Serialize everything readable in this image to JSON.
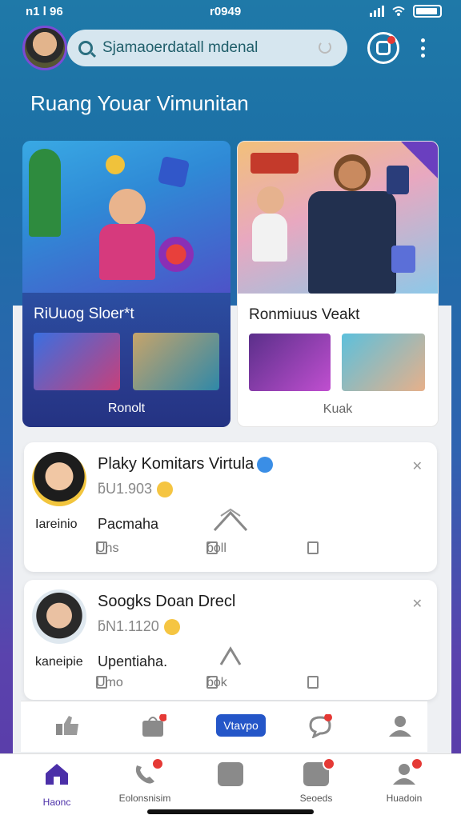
{
  "status_bar": {
    "time_left": "n1 l 96",
    "time_center": "r0949"
  },
  "search": {
    "value": "Sjamaoerdatall mdenal"
  },
  "page_title": "Ruang Youar Vimunitan",
  "cards": [
    {
      "title": "RiUuog Sloer*t",
      "footer": "Ronolt"
    },
    {
      "title": "Ronmiuus Veakt",
      "footer": "Kuak"
    }
  ],
  "posts": [
    {
      "title": "Plaky Komitars Virtula",
      "meta": "ƃU1.903",
      "name": "Iareinio",
      "line": "Pacmaha",
      "actions": [
        "Uns",
        "ɓoll",
        ""
      ]
    },
    {
      "title": "Soogks Doan Drecl",
      "meta": "ƃN1.1120",
      "name": "kaneipie",
      "line": "Upentiaha.",
      "actions": [
        "Umo",
        "ɓok",
        ""
      ]
    }
  ],
  "sub_nav": {
    "pill_label": "Vtavpo"
  },
  "bottom_nav": [
    {
      "label": "Haonc",
      "active": true
    },
    {
      "label": "Eolonsnisim",
      "active": false
    },
    {
      "label": "",
      "active": false
    },
    {
      "label": "Seoeds",
      "active": false
    },
    {
      "label": "Huadoin",
      "active": false
    }
  ],
  "colors": {
    "accent": "#4b2fa8",
    "pill": "#2456c8",
    "notification": "#e53935"
  },
  "icons": [
    "search-icon",
    "instagram-icon",
    "more-icon",
    "close-icon",
    "verified-icon",
    "share-icon",
    "home-icon",
    "phone-icon",
    "chat-icon",
    "gamepad-icon",
    "profile-icon"
  ]
}
